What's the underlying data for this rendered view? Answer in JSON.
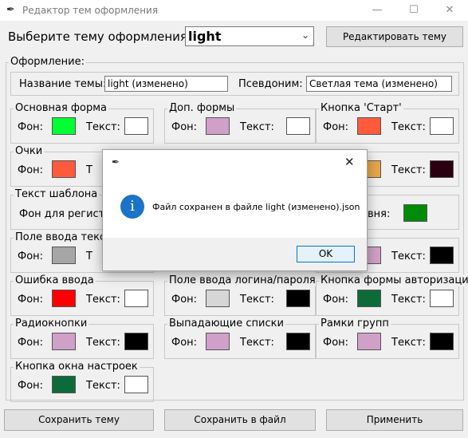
{
  "window": {
    "title": "Редактор тем оформления",
    "minimize": "—",
    "maximize": "☐",
    "close": "✕"
  },
  "theme_select": {
    "label": "Выберите тему оформления >",
    "value": "light",
    "edit_button": "Редактировать тему"
  },
  "appearance": {
    "legend": "Оформление:",
    "name_label": "Название темы:",
    "name_value": "light (изменено)",
    "alias_label": "Псевдоним:",
    "alias_value": "Светлая тема (изменено)"
  },
  "labels": {
    "bg": "Фон:",
    "text": "Текст:"
  },
  "groups": [
    {
      "id": "main-form",
      "title": "Основная форма",
      "bg": "#00ff33",
      "fg": "#ffffff"
    },
    {
      "id": "extra-forms",
      "title": "Доп. формы",
      "bg": "#d0a0c8",
      "fg": "#ffffff"
    },
    {
      "id": "start-button",
      "title": "Кнопка 'Старт'",
      "bg": "#ff5a3c",
      "fg": "#ffffff"
    },
    {
      "id": "points",
      "title": "Очки",
      "bg": "#ff5a3c",
      "fg": null
    },
    {
      "id": "level",
      "title": "",
      "bg": "#e8a64a",
      "fg": "#2a0010"
    },
    {
      "id": "input-field",
      "title": "Поле ввода текста",
      "bg": "#a6a6a6",
      "fg": null
    },
    {
      "id": "hidden-right",
      "title": "",
      "bg": "#d0a0c8",
      "fg": "#000000"
    },
    {
      "id": "input-error",
      "title": "Ошибка ввода",
      "bg": "#ff0000",
      "fg": "#ffffff"
    },
    {
      "id": "login-field",
      "title": "Поле ввода логина/пароля",
      "bg": "#d6d6d6",
      "fg": "#000000"
    },
    {
      "id": "auth-button",
      "title": "Кнопка формы авторизации",
      "bg": "#0d6b3a",
      "fg": "#ffffff"
    },
    {
      "id": "radio-buttons",
      "title": "Радиокнопки",
      "bg": "#d0a0c8",
      "fg": "#000000"
    },
    {
      "id": "dropdowns",
      "title": "Выпадающие списки",
      "bg": "#d0a0c8",
      "fg": "#000000"
    },
    {
      "id": "group-frames",
      "title": "Рамки групп",
      "bg": "#d0a0c8",
      "fg": "#000000"
    },
    {
      "id": "settings-button",
      "title": "Кнопка окна настроек",
      "bg": "#0d6b3a",
      "fg": "#ffffff"
    }
  ],
  "template": {
    "title": "Текст шаблона",
    "reg_label": "Фон для регистро",
    "right_label": "вня:",
    "right_color": "#008c08"
  },
  "bottom": {
    "save_theme": "Сохранить тему",
    "save_file": "Сохранить в файл",
    "apply": "Применить"
  },
  "dialog": {
    "message": "Файл сохранен в файле light (изменено).json",
    "ok": "OK",
    "close": "✕"
  },
  "colors": {
    "accent": "#0078d7",
    "info_icon": "#1a73c8"
  }
}
